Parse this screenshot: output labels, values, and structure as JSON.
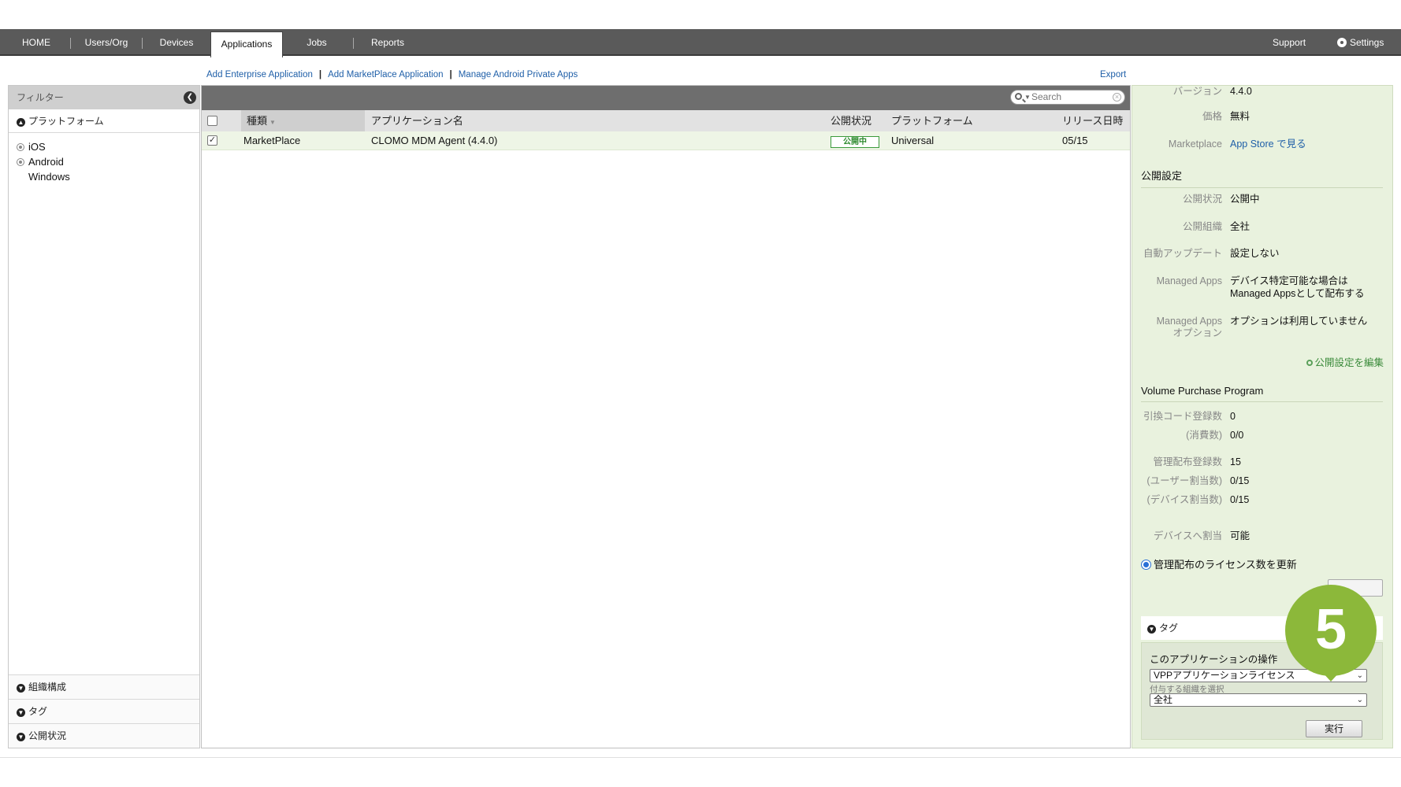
{
  "nav": {
    "tabs": [
      {
        "label": "HOME"
      },
      {
        "label": "Users/Org"
      },
      {
        "label": "Devices"
      },
      {
        "label": "Applications"
      },
      {
        "label": "Jobs"
      },
      {
        "label": "Reports"
      }
    ],
    "active_tab": "Applications",
    "support": "Support",
    "settings": "Settings"
  },
  "sublinks": {
    "add_enterprise": "Add Enterprise Application",
    "add_marketplace": "Add MarketPlace Application",
    "manage_android": "Manage Android Private Apps",
    "separator": "|",
    "export": "Export"
  },
  "filter": {
    "title": "フィルター",
    "platform_section": "プラットフォーム",
    "platforms": [
      "iOS",
      "Android",
      "Windows"
    ],
    "bottom_sections": [
      "組織構成",
      "タグ",
      "公開状況"
    ]
  },
  "search": {
    "placeholder": "Search"
  },
  "table": {
    "columns": [
      "種類",
      "アプリケーション名",
      "公開状況",
      "プラットフォーム",
      "リリース日時"
    ],
    "rows": [
      {
        "type": "MarketPlace",
        "name": "CLOMO MDM Agent (4.4.0)",
        "status": "公開中",
        "platform": "Universal",
        "release": "05/15",
        "checked": true
      }
    ]
  },
  "detail": {
    "version_label": "バージョン",
    "version": "4.4.0",
    "price_label": "価格",
    "price": "無料",
    "marketplace_label": "Marketplace",
    "marketplace_link": "App Store で見る",
    "publish_section": "公開設定",
    "publish_status_label": "公開状況",
    "publish_status": "公開中",
    "publish_org_label": "公開組織",
    "publish_org": "全社",
    "auto_update_label": "自動アップデート",
    "auto_update": "設定しない",
    "managed_apps_label": "Managed Apps",
    "managed_apps_line1": "デバイス特定可能な場合は",
    "managed_apps_line2": "Managed Appsとして配布する",
    "managed_opt_label1": "Managed Apps",
    "managed_opt_label2": "オプション",
    "managed_opt": "オプションは利用していません",
    "edit_publish": "公開設定を編集",
    "vpp_section": "Volume Purchase Program",
    "code_reg_label": "引換コード登録数",
    "code_reg": "0",
    "consumed_label": "(消費数)",
    "consumed": "0/0",
    "managed_reg_label": "管理配布登録数",
    "managed_reg": "15",
    "user_assign_label": "(ユーザー割当数)",
    "user_assign": "0/15",
    "device_assign_label": "(デバイス割当数)",
    "device_assign": "0/15",
    "device_alloc_label": "デバイスへ割当",
    "device_alloc": "可能",
    "update_license": "管理配布のライセンス数を更新",
    "tag_section": "タグ",
    "ops_title": "このアプリケーションの操作",
    "ops_select": "VPPアプリケーションライセンス",
    "ops_sub": "付与する組織を選択",
    "org_select": "全社",
    "run_button": "実行"
  },
  "marker": {
    "number": "5",
    "color": "#8cb83a"
  }
}
